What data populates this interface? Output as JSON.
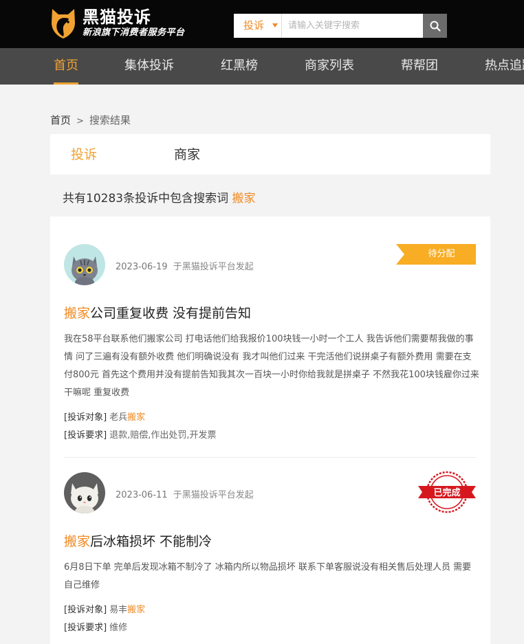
{
  "brand": {
    "name": "黑猫投诉",
    "slogan": "新浪旗下消费者服务平台",
    "accent": "#f0a233",
    "keyword_color": "#f08a24"
  },
  "search": {
    "type_label": "投诉",
    "placeholder": "请输入关键字搜索",
    "value": "",
    "icon": "search-icon"
  },
  "nav": {
    "items": [
      {
        "label": "首页",
        "active": true
      },
      {
        "label": "集体投诉"
      },
      {
        "label": "红黑榜"
      },
      {
        "label": "商家列表"
      },
      {
        "label": "帮帮团"
      },
      {
        "label": "热点追踪"
      }
    ]
  },
  "breadcrumb": {
    "home": "首页",
    "separator": ">",
    "current": "搜索结果"
  },
  "tabs": [
    {
      "label": "投诉",
      "active": true
    },
    {
      "label": "商家"
    }
  ],
  "summary": {
    "text": "共有10283条投诉中包含搜索词",
    "keyword": "搬家"
  },
  "complaints": [
    {
      "date": "2023-06-19",
      "platform": "于黑猫投诉平台发起",
      "status": "待分配",
      "status_type": "ribbon",
      "title_keyword": "搬家",
      "title_rest": "公司重复收费 没有提前告知",
      "description": "我在58平台联系他们搬家公司 打电话他们给我报价100块钱一小时一个工人 我告诉他们需要帮我做的事情 问了三遍有没有额外收费 他们明确说没有 我才叫他们过来 干完活他们说拼桌子有额外费用 需要在支付800元 首先这个费用并没有提前告知我其次一百块一小时你给我就是拼桌子 不然我花100块钱雇你过来干嘛呢 重复收费",
      "target_label": "[投诉对象]",
      "target_prefix": "老兵",
      "target_keyword": "搬家",
      "demand_label": "[投诉要求]",
      "demand": "退款,赔偿,作出处罚,开发票"
    },
    {
      "date": "2023-06-11",
      "platform": "于黑猫投诉平台发起",
      "status": "已完成",
      "status_type": "stamp",
      "title_keyword": "搬家",
      "title_rest": "后冰箱损坏 不能制冷",
      "description": "6月8日下单 完单后发现冰箱不制冷了 冰箱内所以物品损坏 联系下单客服说没有相关售后处理人员 需要自己维修",
      "target_label": "[投诉对象]",
      "target_prefix": "易丰",
      "target_keyword": "搬家",
      "demand_label": "[投诉要求]",
      "demand": "维修"
    }
  ]
}
